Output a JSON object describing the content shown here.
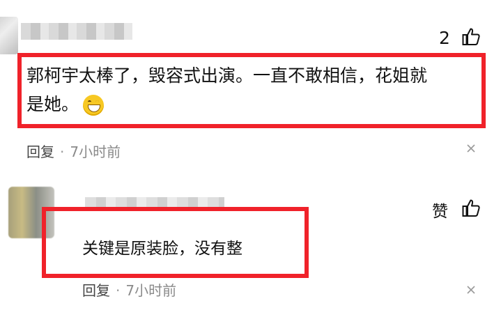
{
  "comments": [
    {
      "like_count": "2",
      "text_line1": "郭柯宇太棒了，毁容式出演。一直不敢相信，花姐就",
      "text_line2": "是她。",
      "emoji": "grinning-face-icon",
      "reply_label": "回复",
      "separator": "·",
      "time": "7小时前"
    },
    {
      "like_label": "赞",
      "text": "关键是原装脸，没有整",
      "reply_label": "回复",
      "separator": "·",
      "time": "7小时前"
    }
  ],
  "colors": {
    "highlight_border": "#f0222a",
    "text": "#111111",
    "meta_text": "#8a8a8a"
  },
  "icons": {
    "like": "thumbs-up-icon",
    "close": "close-icon"
  }
}
